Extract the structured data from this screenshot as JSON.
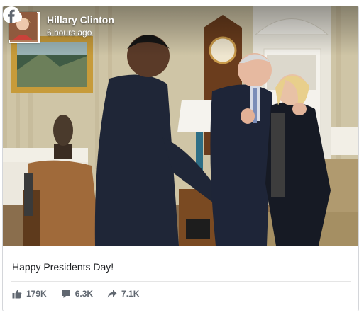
{
  "post": {
    "author": "Hillary Clinton",
    "time": "6 hours ago",
    "caption": "Happy Presidents Day!",
    "verified_icon": "verified-check-icon",
    "platform_icon": "facebook-icon"
  },
  "stats": {
    "likes": "179K",
    "comments": "6.3K",
    "shares": "7.1K"
  },
  "colors": {
    "text_muted": "#606770",
    "card_border": "#d4d6da"
  }
}
